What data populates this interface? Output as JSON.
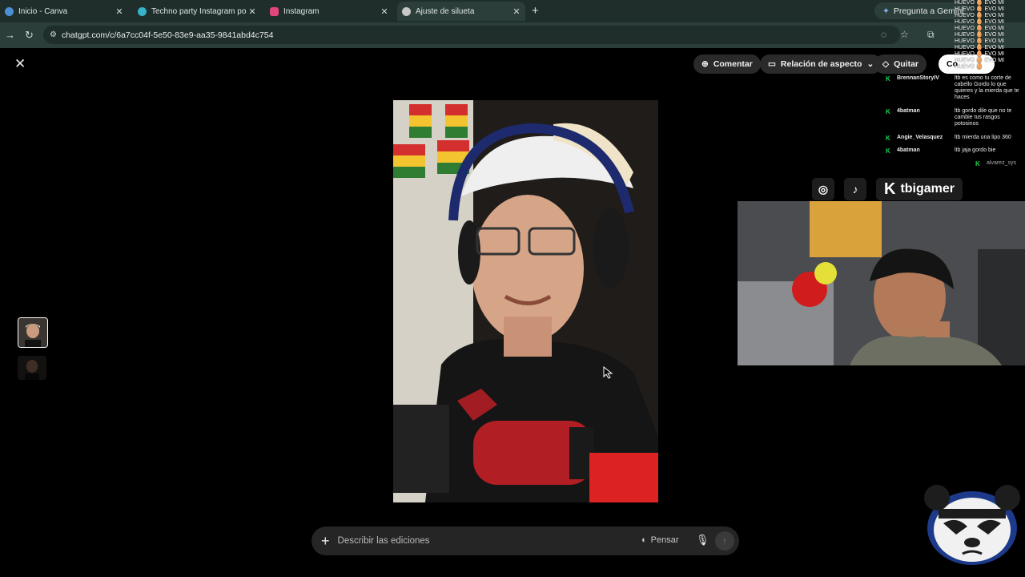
{
  "browser": {
    "tabs": [
      {
        "title": "Inicio - Canva",
        "fav_color": "#4a8fd8"
      },
      {
        "title": "Techno party Instagram post - ",
        "fav_color": "#36b3c9"
      },
      {
        "title": "Instagram",
        "fav_color": "#e0457b"
      },
      {
        "title": "Ajuste de silueta",
        "fav_color": "#c8c8c8"
      }
    ],
    "gemini_button": "Pregunta a Gemini",
    "url": "chatgpt.com/c/6a7cc04f-5e50-83e9-aa35-9841abd4c754"
  },
  "toolbar": {
    "comment": "Comentar",
    "aspect": "Relación de aspecto",
    "remove": "Quitar",
    "extra": "Co"
  },
  "chat": [
    {
      "user": "BrennanStoryIV",
      "msg": "ltb es como tu corte de cabello Gordo lo que quieres y la mierda que te haces"
    },
    {
      "user": "4batman",
      "msg": "ltb gordo dile que no te cambie tus rasgos potosinos"
    },
    {
      "user": "Angie_Velasquez",
      "msg": "ltb mierda una lipo 360"
    },
    {
      "user": "4batman",
      "msg": "ltb jaja gordo bie"
    },
    {
      "user": "alvarez_sys",
      "msg": ""
    }
  ],
  "huevo_lines": [
    "HUEVO 🥚 EVO MI",
    "HUEVO 🥚 EVO MI",
    "HUEVO 🥚 EVO MI",
    "HUEVO 🥚 EVO MI",
    "HUEVO 🥚 EVO MI",
    "HUEVO 🥚 EVO MI",
    "HUEVO 🥚 EVO MI",
    "HUEVO 🥚 EVO MI",
    "HUEVO 🥚 EVO MI",
    "HUEVO 🥚 EVO MI",
    "HUEVO 🥚"
  ],
  "overlay": {
    "brand": "tbigamer"
  },
  "prompt": {
    "placeholder": "Describir las ediciones",
    "think": "Pensar"
  }
}
